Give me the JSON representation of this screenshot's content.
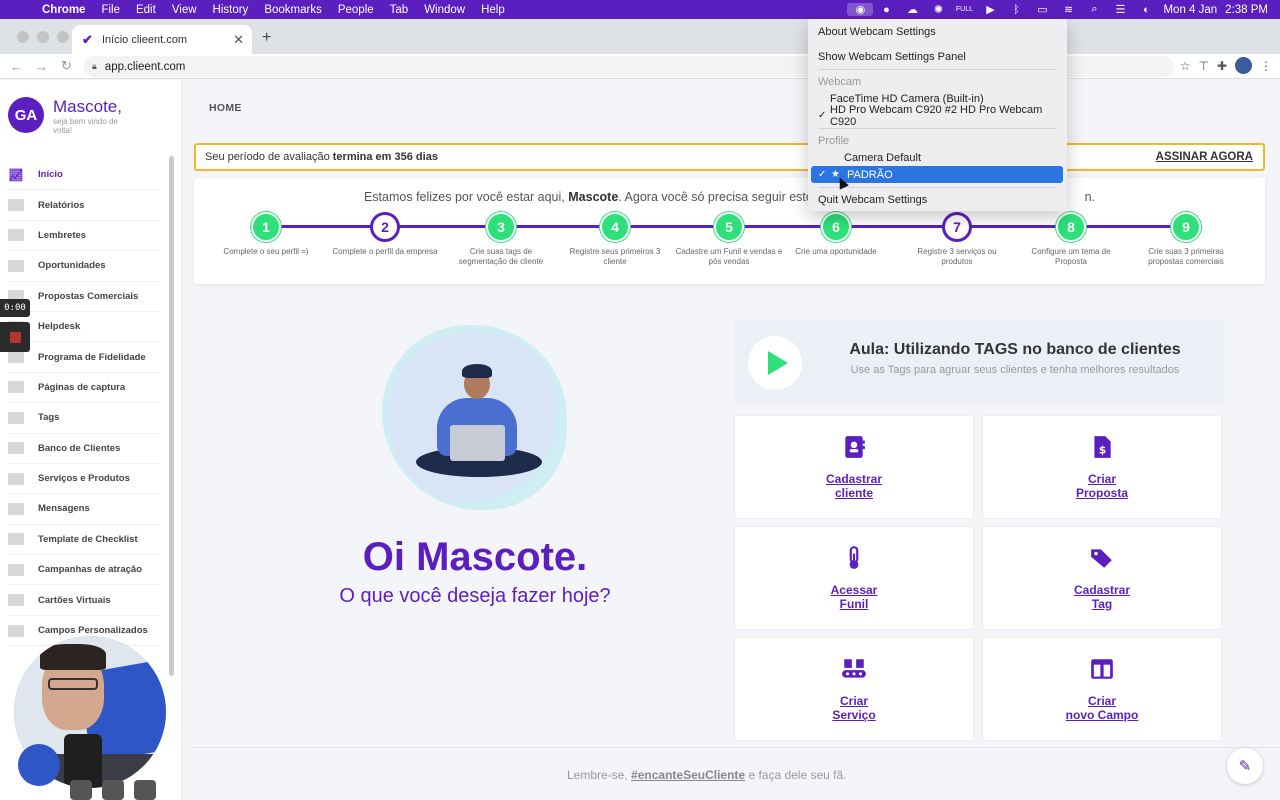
{
  "menubar": {
    "items": [
      "Chrome",
      "File",
      "Edit",
      "View",
      "History",
      "Bookmarks",
      "People",
      "Tab",
      "Window",
      "Help"
    ],
    "status_full": "FULL",
    "date": "Mon 4 Jan",
    "time": "2:38 PM"
  },
  "browser": {
    "tab_title": "Início clieent.com",
    "url": "app.clieent.com"
  },
  "sidebar": {
    "brand_initials": "GA",
    "brand_name": "Mascote,",
    "brand_sub": "seja bem vindo de volta!",
    "items": [
      {
        "label": "Início",
        "icon": "chart-icon"
      },
      {
        "label": "Relatórios",
        "icon": "report-icon"
      },
      {
        "label": "Lembretes",
        "icon": "bell-icon"
      },
      {
        "label": "Oportunidades",
        "icon": "thermometer-icon"
      },
      {
        "label": "Propostas Comerciais",
        "icon": "document-icon"
      },
      {
        "label": "Helpdesk",
        "icon": "help-icon"
      },
      {
        "label": "Programa de Fidelidade",
        "icon": "gift-icon"
      },
      {
        "label": "Páginas de captura",
        "icon": "funnel-icon"
      },
      {
        "label": "Tags",
        "icon": "tag-icon"
      },
      {
        "label": "Banco de Clientes",
        "icon": "contacts-icon"
      },
      {
        "label": "Serviços e Produtos",
        "icon": "box-icon"
      },
      {
        "label": "Mensagens",
        "icon": "mail-icon"
      },
      {
        "label": "Template de Checklist",
        "icon": "check-icon"
      },
      {
        "label": "Campanhas de atração",
        "icon": "megaphone-icon"
      },
      {
        "label": "Cartões Virtuais",
        "icon": "card-icon"
      },
      {
        "label": "Campos Personalizados",
        "icon": "columns-icon"
      }
    ]
  },
  "recorder": {
    "timer": "0:00"
  },
  "main": {
    "breadcrumb": "HOME",
    "trial": {
      "text": "Seu período de avaliação",
      "bold": "termina em 356 dias",
      "cta": "ASSINAR AGORA"
    },
    "welcome": {
      "pre": "Estamos felizes por você estar aqui,",
      "name": "Mascote",
      "post": ". Agora você só precisa seguir estes",
      "tail": "n."
    },
    "steps": [
      {
        "num": "1",
        "label": "Complete o seu perfil =)",
        "done": true
      },
      {
        "num": "2",
        "label": "Complete o perfil da empresa",
        "done": false
      },
      {
        "num": "3",
        "label": "Crie suas tags de segmentação de cliente",
        "done": true
      },
      {
        "num": "4",
        "label": "Registre seus primeiros 3 cliente",
        "done": true
      },
      {
        "num": "5",
        "label": "Cadastre um Funil e vendas e pós vendas",
        "done": true
      },
      {
        "num": "6",
        "label": "Crie uma oportunidade",
        "done": true
      },
      {
        "num": "7",
        "label": "Registre 3 serviços ou produtos",
        "done": false
      },
      {
        "num": "8",
        "label": "Configure um tema de Proposta",
        "done": true
      },
      {
        "num": "9",
        "label": "Crie suas 3 primeiras propostas comerciais",
        "done": true
      }
    ],
    "hero_title": "Oi Mascote.",
    "hero_sub": "O que você deseja fazer hoje?",
    "lesson": {
      "title": "Aula: Utilizando TAGS no banco de clientes",
      "subtitle": "Use as Tags para agruar seus clientes e tenha melhores resultados"
    },
    "actions": [
      {
        "line1": "Cadastrar",
        "line2": "cliente",
        "icon": "contact-card-icon"
      },
      {
        "line1": "Criar",
        "line2": "Proposta",
        "icon": "invoice-icon"
      },
      {
        "line1": "Acessar",
        "line2": "Funil",
        "icon": "thermometer-icon"
      },
      {
        "line1": "Cadastrar",
        "line2": "Tag",
        "icon": "tags-icon"
      },
      {
        "line1": "Criar",
        "line2": "Serviço",
        "icon": "conveyor-icon"
      },
      {
        "line1": "Criar",
        "line2": "novo Campo",
        "icon": "columns-icon"
      }
    ],
    "footer": {
      "pre": "Lembre-se,",
      "hashtag": "#encanteSeuCliente",
      "post": "e faça dele seu fã."
    }
  },
  "webcam_menu": {
    "about": "About Webcam Settings",
    "show_panel": "Show Webcam Settings Panel",
    "webcam_header": "Webcam",
    "cam1": "FaceTime HD Camera (Built-in)",
    "cam2": "HD Pro Webcam C920 #2 HD Pro Webcam C920",
    "profile_header": "Profile",
    "profile1": "Camera Default",
    "profile2": "PADRÃO",
    "quit": "Quit Webcam Settings"
  },
  "colors": {
    "brand_purple": "#5b1fbf",
    "step_green": "#2ee07a",
    "trial_border": "#f2b728",
    "menu_selection": "#2b75e3"
  }
}
